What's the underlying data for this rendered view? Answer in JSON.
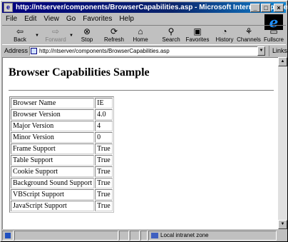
{
  "window": {
    "title": "http://ntserver/components/BrowserCapabilities.asp - Microsoft Internet Explorer",
    "controls": [
      "_",
      "□",
      "×"
    ]
  },
  "menu": [
    "File",
    "Edit",
    "View",
    "Go",
    "Favorites",
    "Help"
  ],
  "toolbar": [
    {
      "label": "Back",
      "icon": "back-arrow-icon",
      "enabled": true
    },
    {
      "label": "Forward",
      "icon": "forward-arrow-icon",
      "enabled": false
    },
    {
      "label": "Stop",
      "icon": "stop-icon",
      "enabled": true
    },
    {
      "label": "Refresh",
      "icon": "refresh-icon",
      "enabled": true
    },
    {
      "label": "Home",
      "icon": "home-icon",
      "enabled": true
    },
    {
      "label": "Search",
      "icon": "search-icon",
      "enabled": true
    },
    {
      "label": "Favorites",
      "icon": "favorites-icon",
      "enabled": true
    },
    {
      "label": "History",
      "icon": "history-icon",
      "enabled": true
    },
    {
      "label": "Channels",
      "icon": "channels-icon",
      "enabled": true
    },
    {
      "label": "Fullscre",
      "icon": "fullscreen-icon",
      "enabled": true
    }
  ],
  "address": {
    "label": "Address",
    "value": "http://ntserver/components/BrowserCapabilities.asp",
    "links_label": "Links"
  },
  "page": {
    "heading": "Browser Capabilities Sample",
    "rows": [
      {
        "key": "Browser Name",
        "value": "IE"
      },
      {
        "key": "Browser Version",
        "value": "4.0"
      },
      {
        "key": "Major Version",
        "value": "4"
      },
      {
        "key": "Minor Version",
        "value": "0"
      },
      {
        "key": "Frame Support",
        "value": "True"
      },
      {
        "key": "Table Support",
        "value": "True"
      },
      {
        "key": "Cookie Support",
        "value": "True"
      },
      {
        "key": "Background Sound Support",
        "value": "True"
      },
      {
        "key": "VBScript Support",
        "value": "True"
      },
      {
        "key": "JavaScript Support",
        "value": "True"
      }
    ]
  },
  "status": {
    "zone": "Local intranet zone"
  },
  "colors": {
    "titlebar": "#000080",
    "chrome": "#c0c0c0",
    "ie_logo": "#1e90ff"
  }
}
